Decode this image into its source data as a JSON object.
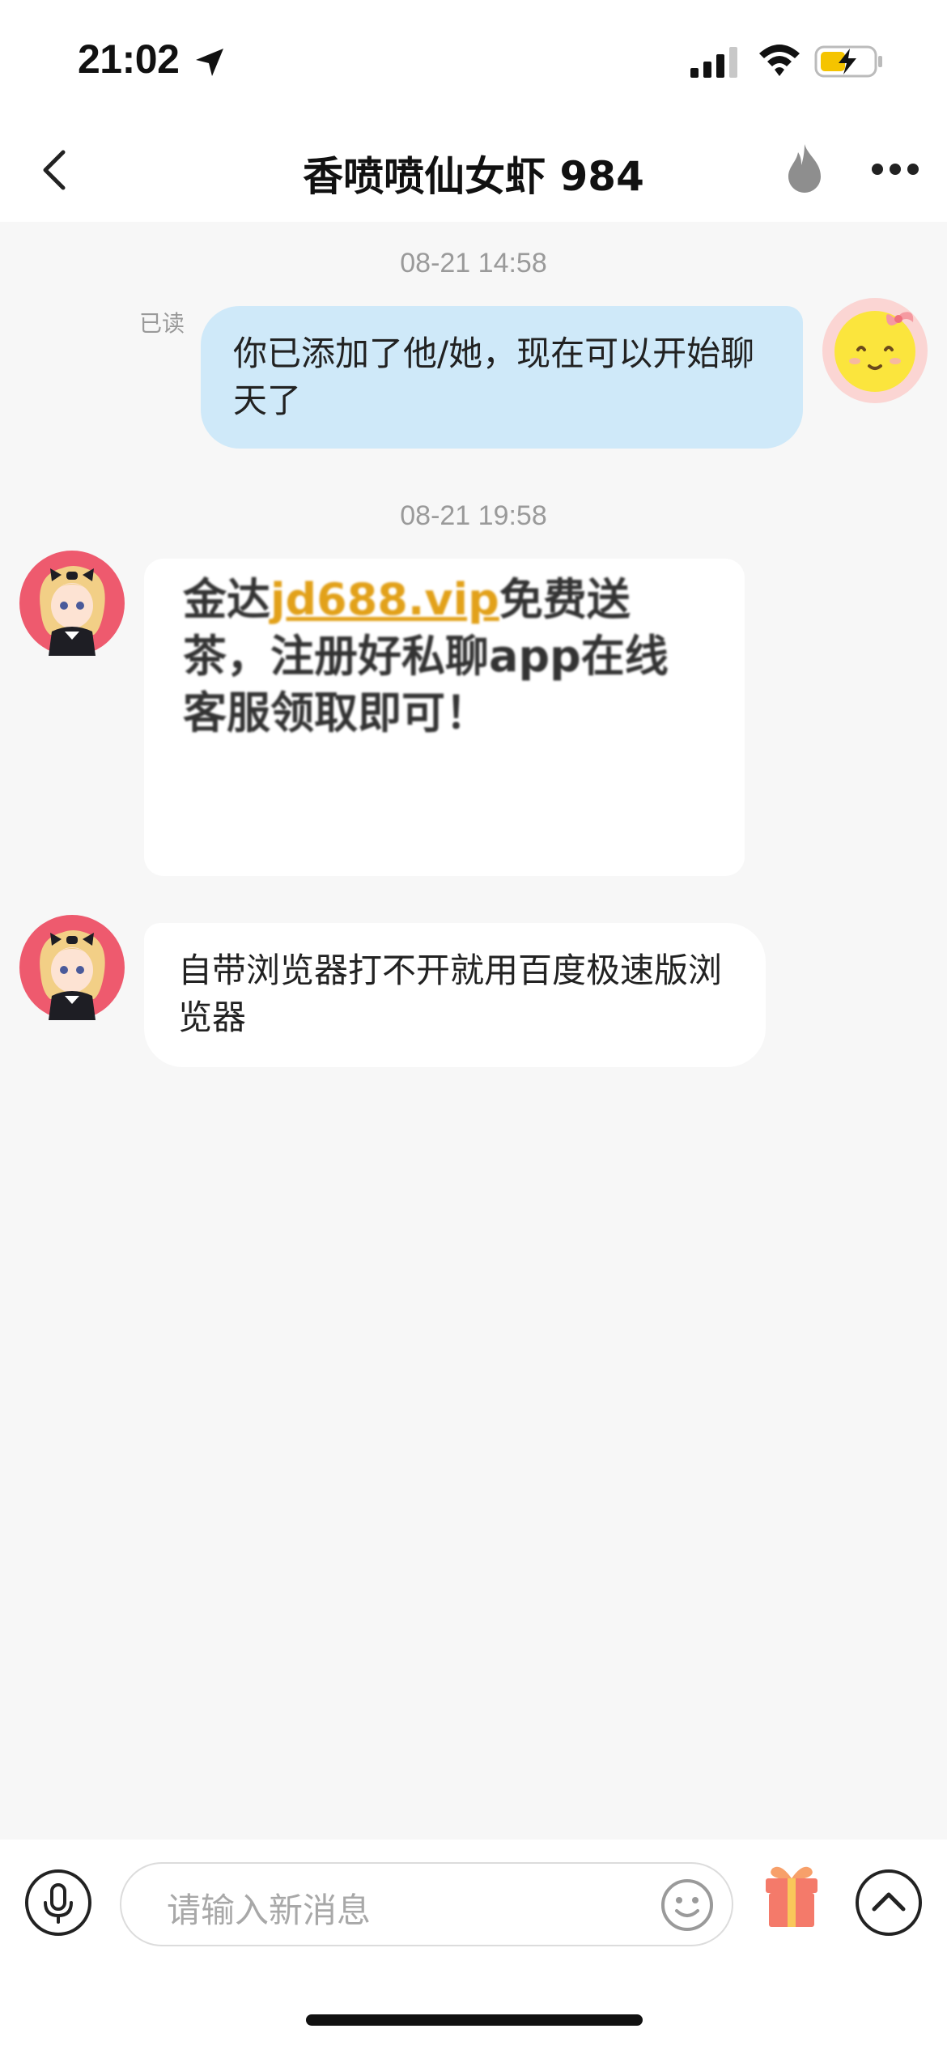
{
  "status_bar": {
    "time": "21:02"
  },
  "header": {
    "title": "香喷喷仙女虾 984",
    "back_icon": "chevron-left-icon",
    "flame_icon": "flame-icon",
    "more_icon": "more-dots-icon"
  },
  "messages": [
    {
      "timestamp": "08-21 14:58",
      "sender": "me",
      "read_label": "已读",
      "text": "你已添加了他/她，现在可以开始聊天了"
    },
    {
      "timestamp": "08-21 19:58",
      "sender": "other",
      "text_before_link": "金达",
      "link": "jd688.vip",
      "text_after_link": "免费送茶，注册好私聊app在线客服领取即可！"
    },
    {
      "sender": "other",
      "text": "自带浏览器打不开就用百度极速版浏览器"
    }
  ],
  "input_bar": {
    "placeholder": "请输入新消息",
    "mic_icon": "microphone-icon",
    "emoji_icon": "emoji-icon",
    "gift_icon": "gift-icon",
    "expand_icon": "chevron-up-icon"
  },
  "colors": {
    "my_bubble": "#cfe9f9",
    "link": "#e2a11a",
    "background": "#f7f7f7",
    "gift": "#f47a6a"
  }
}
